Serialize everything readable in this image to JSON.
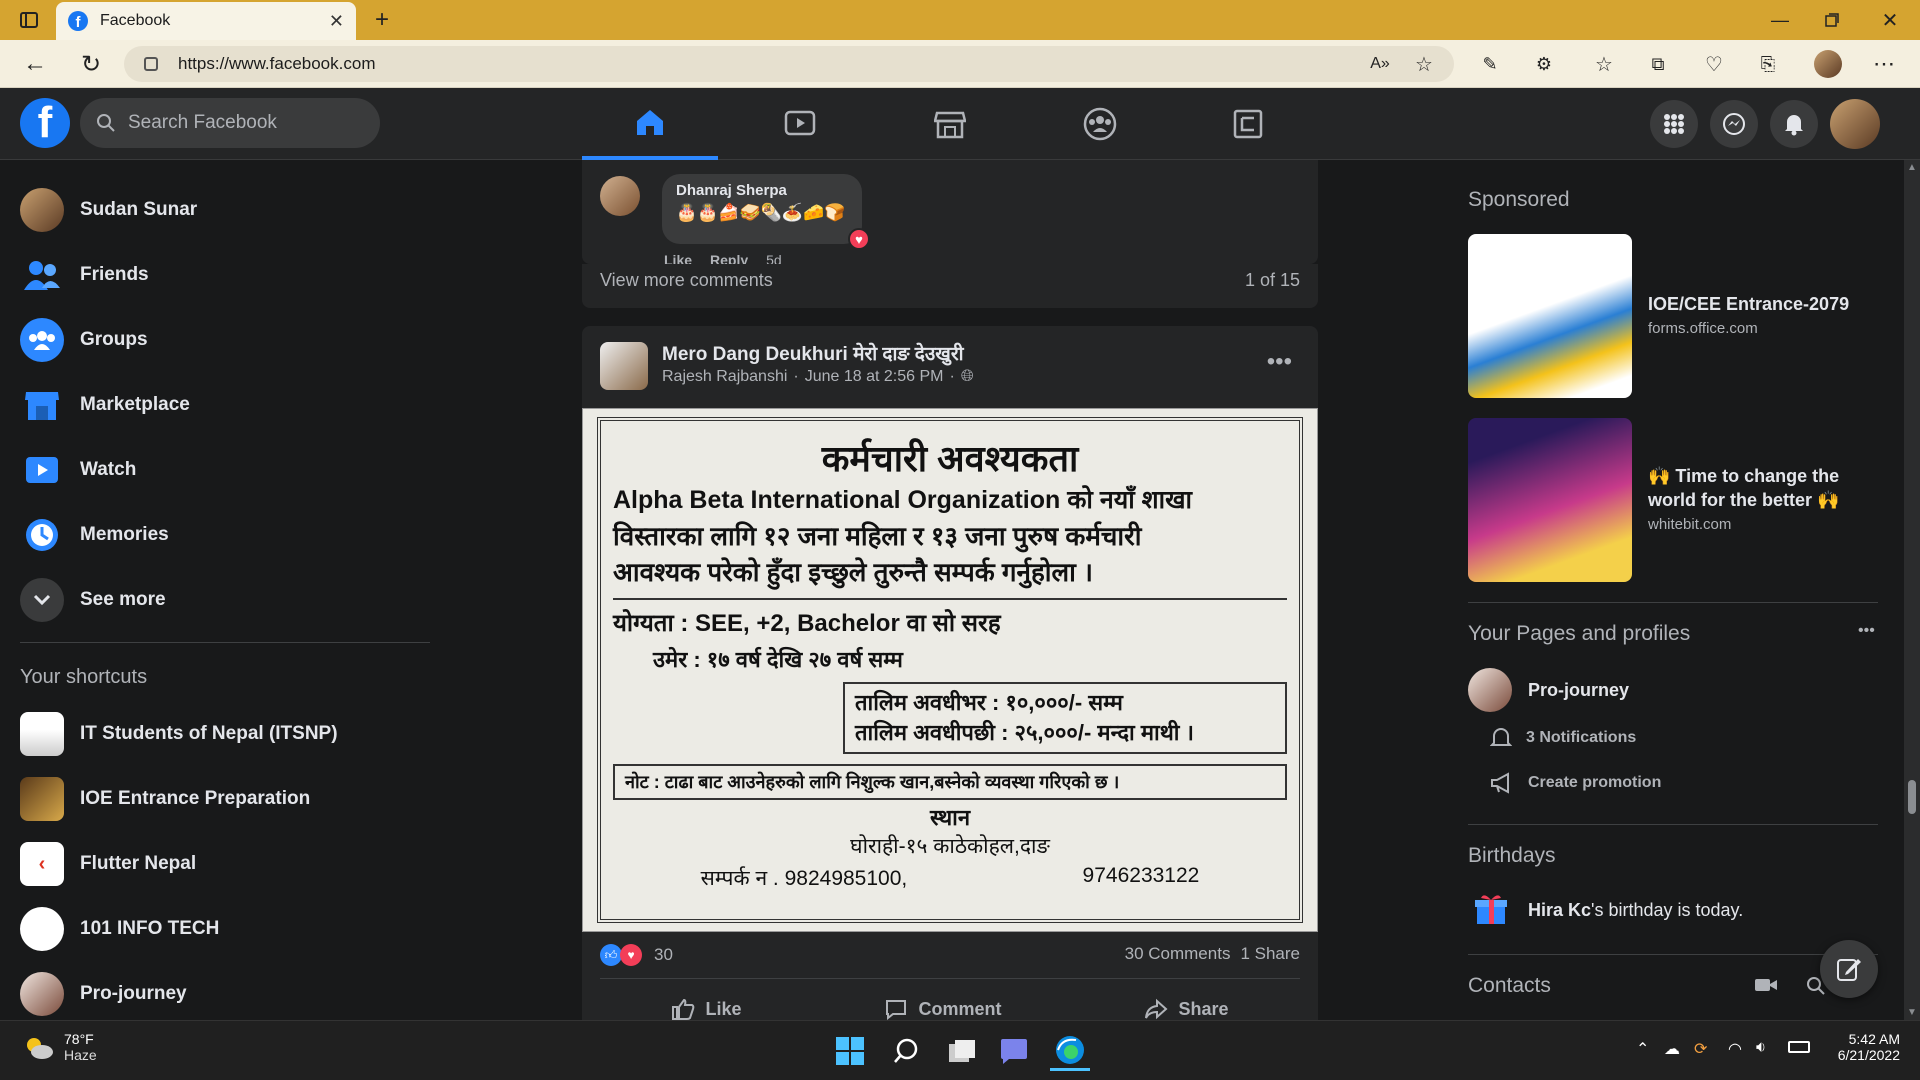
{
  "browser": {
    "tab_title": "Facebook",
    "url": "https://www.facebook.com"
  },
  "header": {
    "search_placeholder": "Search Facebook"
  },
  "sidebar": {
    "items": [
      {
        "label": "Sudan Sunar"
      },
      {
        "label": "Friends"
      },
      {
        "label": "Groups"
      },
      {
        "label": "Marketplace"
      },
      {
        "label": "Watch"
      },
      {
        "label": "Memories"
      },
      {
        "label": "See more"
      }
    ],
    "shortcuts_title": "Your shortcuts",
    "shortcuts": [
      {
        "label": "IT Students of Nepal (ITSNP)"
      },
      {
        "label": "IOE Entrance Preparation"
      },
      {
        "label": "Flutter Nepal"
      },
      {
        "label": "101 INFO TECH"
      },
      {
        "label": "Pro-journey"
      }
    ]
  },
  "feed": {
    "comment": {
      "author": "Dhanraj Sherpa",
      "text": "🎂🎂🍰🥪🌯🍝🧀🍞",
      "like_label": "Like",
      "reply_label": "Reply",
      "age": "5d"
    },
    "view_more": "View more comments",
    "comment_count": "1 of 15",
    "post": {
      "page_name": "Mero Dang Deukhuri मेरो दाङ देउखुरी",
      "author": "Rajesh Rajbanshi",
      "date": "June 18 at 2:56 PM",
      "reactions": "30",
      "comments": "30 Comments",
      "shares": "1 Share",
      "like_label": "Like",
      "comment_label": "Comment",
      "share_label": "Share",
      "notice": {
        "title": "कर्मचारी अवश्यकता",
        "line1": "Alpha Beta International Organization को नयाँ शाखा",
        "line2": "विस्तारका लागि १२ जना महिला र १३ जना पुरुष कर्मचारी",
        "line3": "आवश्यक परेको हुँदा इच्छुले तुरुन्तै सम्पर्क गर्नुहोला ।",
        "qual": "योग्यता : SEE, +2, Bachelor वा सो सरह",
        "age": "उमेर : १७ वर्ष देखि २७ वर्ष सम्म",
        "pay1": "तालिम अवधीभर : १०,०००/- सम्म",
        "pay2": "तालिम अवधीपछी : २५,०००/- मन्दा माथी ।",
        "note": "नोट : टाढा बाट आउनेहरुको लागि निशुल्क खान,बस्नेको व्यवस्था गरिएको छ ।",
        "place_title": "स्थान",
        "place": "घोराही-१५ काठेकोहल,दाङ",
        "contact": "सम्पर्क न . 9824985100,",
        "contact2": "9746233122"
      }
    }
  },
  "right": {
    "sponsored_title": "Sponsored",
    "ads": [
      {
        "title": "IOE/CEE Entrance-2079",
        "domain": "forms.office.com"
      },
      {
        "title": "🙌 Time to change the world for the better 🙌",
        "domain": "whitebit.com"
      }
    ],
    "pages_title": "Your Pages and profiles",
    "page_name": "Pro-journey",
    "notifications": "3 Notifications",
    "create_promotion": "Create promotion",
    "birthdays_title": "Birthdays",
    "birthday_name": "Hira Kc",
    "birthday_text": "'s birthday is today.",
    "contacts_title": "Contacts"
  },
  "taskbar": {
    "temp": "78°F",
    "weather": "Haze",
    "time": "5:42 AM",
    "date": "6/21/2022"
  },
  "colors": {
    "fb_blue": "#1877f2",
    "tab_bar": "#d5a430",
    "dark_bg": "#18191a",
    "card_bg": "#242526"
  }
}
